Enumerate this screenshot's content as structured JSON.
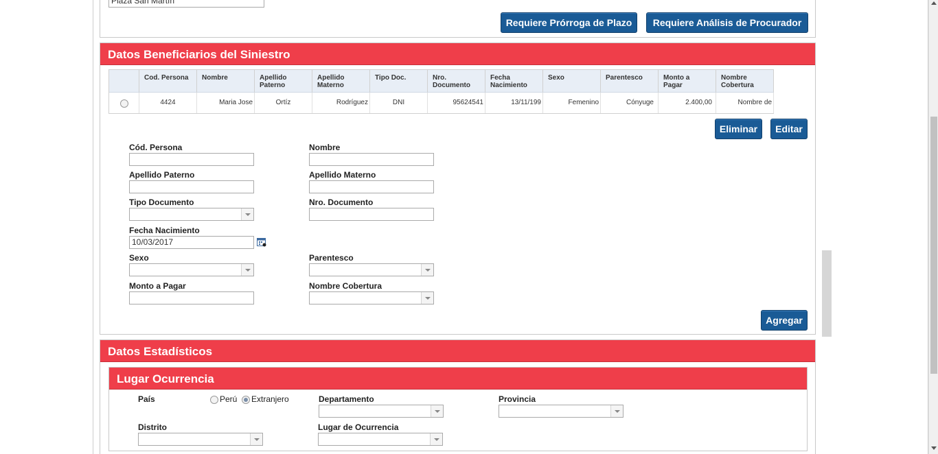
{
  "top": {
    "address_value": "Plaza San Martín",
    "btn_prorroga": "Requiere Prórroga de Plazo",
    "btn_analisis": "Requiere Análisis de Procurador"
  },
  "beneficiarios": {
    "title": "Datos Beneficiarios del Siniestro",
    "columns": {
      "cod": "Cod. Persona",
      "nombre": "Nombre",
      "ap_paterno_1": "Apellido",
      "ap_paterno_2": "Paterno",
      "ap_materno_1": "Apellido",
      "ap_materno_2": "Materno",
      "tipo_doc": "Tipo Doc.",
      "nro_doc_1": "Nro.",
      "nro_doc_2": "Documento",
      "fecha_1": "Fecha",
      "fecha_2": "Nacimiento",
      "sexo": "Sexo",
      "parentesco": "Parentesco",
      "monto_1": "Monto a",
      "monto_2": "Pagar",
      "cobertura_1": "Nombre",
      "cobertura_2": "Cobertura"
    },
    "row": {
      "cod": "4424",
      "nombre": "Maria Jose",
      "ap_paterno": "Ortíz",
      "ap_materno": "Rodríguez",
      "tipo_doc": "DNI",
      "nro_doc": "95624541",
      "fecha": "13/11/199",
      "sexo": "Femenino",
      "parentesco": "Cónyuge",
      "monto": "2.400,00",
      "cobertura": "Nombre de"
    },
    "btn_eliminar": "Eliminar",
    "btn_editar": "Editar",
    "form": {
      "cod_label": "Cód. Persona",
      "nombre_label": "Nombre",
      "ap_paterno_label": "Apellido Paterno",
      "ap_materno_label": "Apellido Materno",
      "tipo_doc_label": "Tipo Documento",
      "nro_doc_label": "Nro. Documento",
      "fecha_label": "Fecha Nacimiento",
      "fecha_value": "10/03/2017",
      "sexo_label": "Sexo",
      "parentesco_label": "Parentesco",
      "monto_label": "Monto a Pagar",
      "cobertura_label": "Nombre Cobertura"
    },
    "btn_agregar": "Agregar"
  },
  "estadisticos": {
    "title": "Datos Estadísticos",
    "lugar": {
      "title": "Lugar Ocurrencia",
      "pais_label": "País",
      "opt_peru": "Perú",
      "opt_extranjero": "Extranjero",
      "departamento_label": "Departamento",
      "provincia_label": "Provincia",
      "distrito_label": "Distrito",
      "lugar_label": "Lugar de Ocurrencia"
    }
  },
  "colors": {
    "header_red": "#ef3e4a",
    "button_blue": "#1a5b96"
  }
}
